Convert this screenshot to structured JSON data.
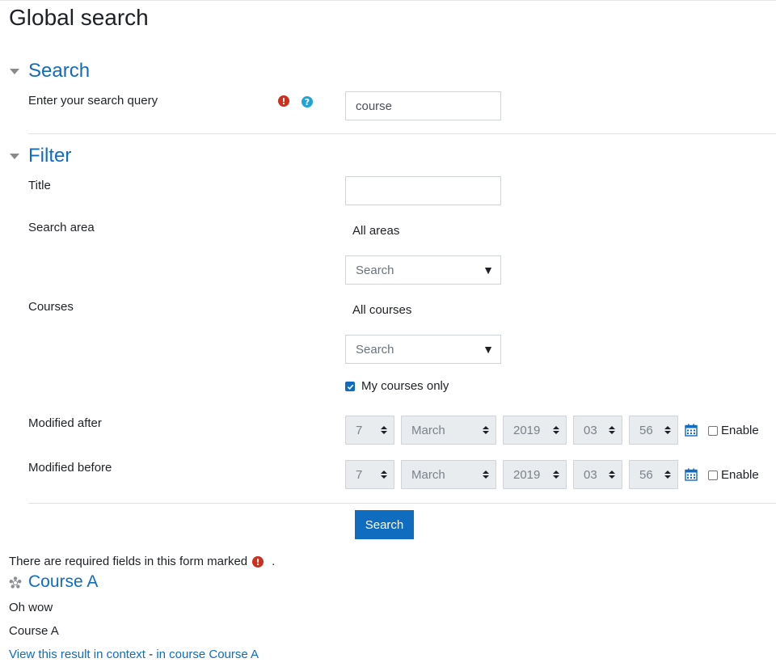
{
  "page": {
    "title": "Global search"
  },
  "search_section": {
    "title": "Search",
    "query_label": "Enter your search query",
    "required_icon": "exclamation-circle-icon",
    "help_icon": "question-circle-icon",
    "query_value": "course"
  },
  "filter_section": {
    "title": "Filter",
    "title_label": "Title",
    "title_value": "",
    "search_area": {
      "label": "Search area",
      "selection": "All areas",
      "placeholder": "Search"
    },
    "courses": {
      "label": "Courses",
      "selection": "All courses",
      "placeholder": "Search",
      "my_courses_label": "My courses only",
      "my_courses_checked": true
    },
    "modified_after": {
      "label": "Modified after",
      "day": "7",
      "month": "March",
      "year": "2019",
      "hour": "03",
      "minute": "56",
      "enable_label": "Enable",
      "enabled": false
    },
    "modified_before": {
      "label": "Modified before",
      "day": "7",
      "month": "March",
      "year": "2019",
      "hour": "03",
      "minute": "56",
      "enable_label": "Enable",
      "enabled": false
    }
  },
  "submit": {
    "label": "Search"
  },
  "required_note": {
    "text": "There are required fields in this form marked",
    "suffix": "."
  },
  "result": {
    "icon": "course-icon",
    "title": "Course A",
    "content": "Oh wow",
    "course_name": "Course A",
    "context_link": "View this result in context",
    "separator": " - ",
    "course_link": "in course Course A"
  },
  "colors": {
    "link": "#0f6cbf",
    "required": "#ca3120",
    "help": "#1ea5d6",
    "button": "#0f6cbf"
  }
}
